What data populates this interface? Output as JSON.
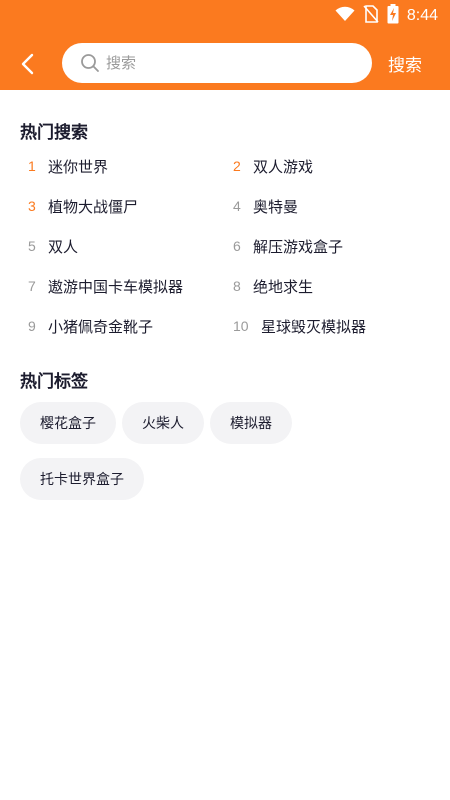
{
  "status_bar": {
    "time": "8:44",
    "icons": [
      "wifi-icon",
      "no-sim-icon",
      "battery-charging-icon"
    ]
  },
  "header": {
    "back_icon": "chevron-left-icon",
    "search": {
      "placeholder": "搜索",
      "value": ""
    },
    "search_button_label": "搜索",
    "colors": {
      "accent": "#fb7a1f",
      "search_bg": "#ffffff"
    }
  },
  "hot_search": {
    "title": "热门搜索",
    "items": [
      {
        "rank": "1",
        "label": "迷你世界"
      },
      {
        "rank": "2",
        "label": "双人游戏"
      },
      {
        "rank": "3",
        "label": "植物大战僵尸"
      },
      {
        "rank": "4",
        "label": "奥特曼"
      },
      {
        "rank": "5",
        "label": "双人"
      },
      {
        "rank": "6",
        "label": "解压游戏盒子"
      },
      {
        "rank": "7",
        "label": "遨游中国卡车模拟器"
      },
      {
        "rank": "8",
        "label": "绝地求生"
      },
      {
        "rank": "9",
        "label": "小猪佩奇金靴子"
      },
      {
        "rank": "10",
        "label": "星球毁灭模拟器"
      }
    ],
    "highlight_color": "#fb7a1f"
  },
  "hot_tags": {
    "title": "热门标签",
    "items": [
      "樱花盒子",
      "火柴人",
      "模拟器",
      "托卡世界盒子"
    ]
  }
}
